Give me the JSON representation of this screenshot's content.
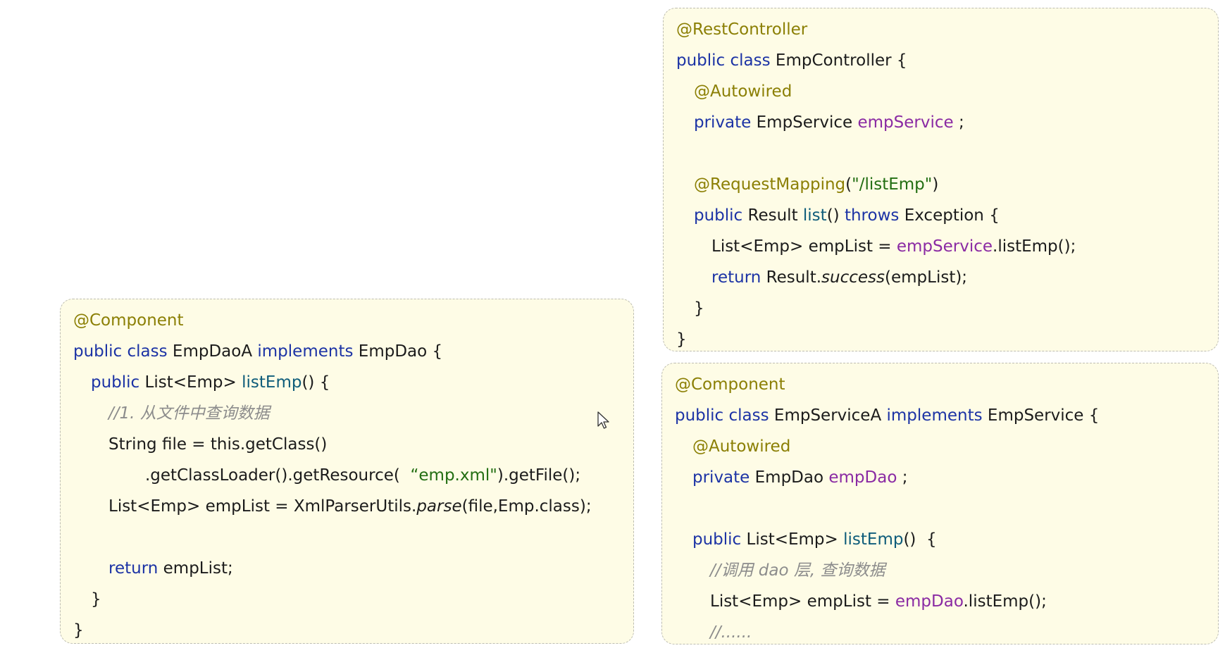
{
  "panels": [
    {
      "id": "emp-controller",
      "lines": [
        {
          "indent": 0,
          "tokens": [
            {
              "t": "@RestController",
              "k": "ann"
            }
          ]
        },
        {
          "indent": 0,
          "tokens": [
            {
              "t": "public class ",
              "k": "kw"
            },
            {
              "t": "EmpController {",
              "k": "pl"
            }
          ]
        },
        {
          "indent": 1,
          "tokens": [
            {
              "t": "@Autowired",
              "k": "ann"
            }
          ]
        },
        {
          "indent": 1,
          "tokens": [
            {
              "t": "private ",
              "k": "kw"
            },
            {
              "t": "EmpService ",
              "k": "pl"
            },
            {
              "t": "empService",
              "k": "fld"
            },
            {
              "t": " ;",
              "k": "pl"
            }
          ]
        },
        {
          "indent": 0,
          "tokens": []
        },
        {
          "indent": 1,
          "tokens": [
            {
              "t": "@RequestMapping",
              "k": "ann"
            },
            {
              "t": "(",
              "k": "pl"
            },
            {
              "t": "\"/listEmp\"",
              "k": "str"
            },
            {
              "t": ")",
              "k": "pl"
            }
          ]
        },
        {
          "indent": 1,
          "tokens": [
            {
              "t": "public ",
              "k": "kw"
            },
            {
              "t": "Result ",
              "k": "pl"
            },
            {
              "t": "list",
              "k": "fn"
            },
            {
              "t": "() ",
              "k": "pl"
            },
            {
              "t": "throws ",
              "k": "kw"
            },
            {
              "t": "Exception {",
              "k": "pl"
            }
          ]
        },
        {
          "indent": 2,
          "tokens": [
            {
              "t": "List<Emp> empList = ",
              "k": "pl"
            },
            {
              "t": "empService",
              "k": "fld"
            },
            {
              "t": ".listEmp();",
              "k": "pl"
            }
          ]
        },
        {
          "indent": 2,
          "tokens": [
            {
              "t": "return ",
              "k": "kw"
            },
            {
              "t": "Result.",
              "k": "pl"
            },
            {
              "t": "success",
              "k": "it"
            },
            {
              "t": "(empList);",
              "k": "pl"
            }
          ]
        },
        {
          "indent": 1,
          "tokens": [
            {
              "t": "}",
              "k": "pl"
            }
          ]
        },
        {
          "indent": 0,
          "tokens": [
            {
              "t": "}",
              "k": "pl"
            }
          ]
        }
      ]
    },
    {
      "id": "emp-dao-a",
      "lines": [
        {
          "indent": 0,
          "tokens": [
            {
              "t": "@Component",
              "k": "ann"
            }
          ]
        },
        {
          "indent": 0,
          "tokens": [
            {
              "t": "public class ",
              "k": "kw"
            },
            {
              "t": "EmpDaoA ",
              "k": "pl"
            },
            {
              "t": "implements ",
              "k": "kw"
            },
            {
              "t": "EmpDao {",
              "k": "pl"
            }
          ]
        },
        {
          "indent": 1,
          "tokens": [
            {
              "t": "public ",
              "k": "kw"
            },
            {
              "t": "List<Emp> ",
              "k": "pl"
            },
            {
              "t": "listEmp",
              "k": "fn"
            },
            {
              "t": "() {",
              "k": "pl"
            }
          ]
        },
        {
          "indent": 2,
          "tokens": [
            {
              "t": "//1. 从文件中查询数据",
              "k": "cm"
            }
          ]
        },
        {
          "indent": 2,
          "tokens": [
            {
              "t": "String file = this.getClass()",
              "k": "pl"
            }
          ]
        },
        {
          "indent": 3,
          "tokens": [
            {
              "t": ".getClassLoader().getResource(  ",
              "k": "pl"
            },
            {
              "t": "“emp.xml\"",
              "k": "str"
            },
            {
              "t": ").getFile();",
              "k": "pl"
            }
          ]
        },
        {
          "indent": 2,
          "tokens": [
            {
              "t": "List<Emp> empList = XmlParserUtils.",
              "k": "pl"
            },
            {
              "t": "parse",
              "k": "it"
            },
            {
              "t": "(file,Emp.class);",
              "k": "pl"
            }
          ]
        },
        {
          "indent": 0,
          "tokens": []
        },
        {
          "indent": 2,
          "tokens": [
            {
              "t": "return ",
              "k": "kw"
            },
            {
              "t": "empList;",
              "k": "pl"
            }
          ]
        },
        {
          "indent": 1,
          "tokens": [
            {
              "t": "}",
              "k": "pl"
            }
          ]
        },
        {
          "indent": 0,
          "tokens": [
            {
              "t": "}",
              "k": "pl"
            }
          ]
        }
      ]
    },
    {
      "id": "emp-service-a",
      "lines": [
        {
          "indent": 0,
          "tokens": [
            {
              "t": "@Component",
              "k": "ann"
            }
          ]
        },
        {
          "indent": 0,
          "tokens": [
            {
              "t": "public class ",
              "k": "kw"
            },
            {
              "t": "EmpServiceA ",
              "k": "pl"
            },
            {
              "t": "implements ",
              "k": "kw"
            },
            {
              "t": "EmpService {",
              "k": "pl"
            }
          ]
        },
        {
          "indent": 1,
          "tokens": [
            {
              "t": "@Autowired",
              "k": "ann"
            }
          ]
        },
        {
          "indent": 1,
          "tokens": [
            {
              "t": "private ",
              "k": "kw"
            },
            {
              "t": "EmpDao ",
              "k": "pl"
            },
            {
              "t": "empDao",
              "k": "fld"
            },
            {
              "t": " ;",
              "k": "pl"
            }
          ]
        },
        {
          "indent": 0,
          "tokens": []
        },
        {
          "indent": 1,
          "tokens": [
            {
              "t": "public ",
              "k": "kw"
            },
            {
              "t": "List<Emp> ",
              "k": "pl"
            },
            {
              "t": "listEmp",
              "k": "fn"
            },
            {
              "t": "()  {",
              "k": "pl"
            }
          ]
        },
        {
          "indent": 2,
          "tokens": [
            {
              "t": "//调用 dao 层, 查询数据",
              "k": "cm"
            }
          ]
        },
        {
          "indent": 2,
          "tokens": [
            {
              "t": "List<Emp> empList = ",
              "k": "pl"
            },
            {
              "t": "empDao",
              "k": "fld"
            },
            {
              "t": ".listEmp();",
              "k": "pl"
            }
          ]
        },
        {
          "indent": 2,
          "tokens": [
            {
              "t": "//......",
              "k": "cm"
            }
          ]
        }
      ]
    }
  ],
  "colors": {
    "panel_background": "#fefce6",
    "panel_border": "#bdbdb2",
    "annotation": "#8b7f04",
    "keyword": "#1c33a5",
    "method": "#0e5c7a",
    "field": "#8a2aa3",
    "string": "#226e12",
    "comment": "#8c8c8c",
    "plain": "#1b1b1b"
  },
  "icons": {
    "cursor": "mouse-pointer-icon"
  }
}
